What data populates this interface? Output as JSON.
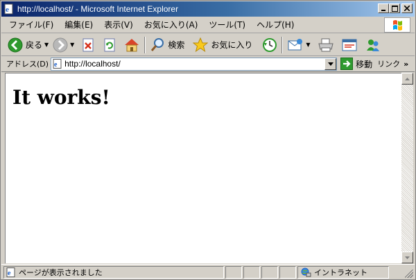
{
  "window": {
    "title": "http://localhost/ - Microsoft Internet Explorer"
  },
  "menu": {
    "items": [
      "ファイル(F)",
      "編集(E)",
      "表示(V)",
      "お気に入り(A)",
      "ツール(T)",
      "ヘルプ(H)"
    ]
  },
  "toolbar": {
    "back_label": "戻る",
    "search_label": "検索",
    "favorites_label": "お気に入り"
  },
  "address": {
    "label": "アドレス(D)",
    "value": "http://localhost/",
    "go_label": "移動",
    "links_label": "リンク",
    "more": "»"
  },
  "page": {
    "heading": "It works!"
  },
  "status": {
    "text": "ページが表示されました",
    "zone": "イントラネット"
  },
  "colors": {
    "title_start": "#0a246a",
    "title_end": "#a6caf0",
    "chrome": "#d4d0c8",
    "back_green": "#2e9a2e"
  }
}
